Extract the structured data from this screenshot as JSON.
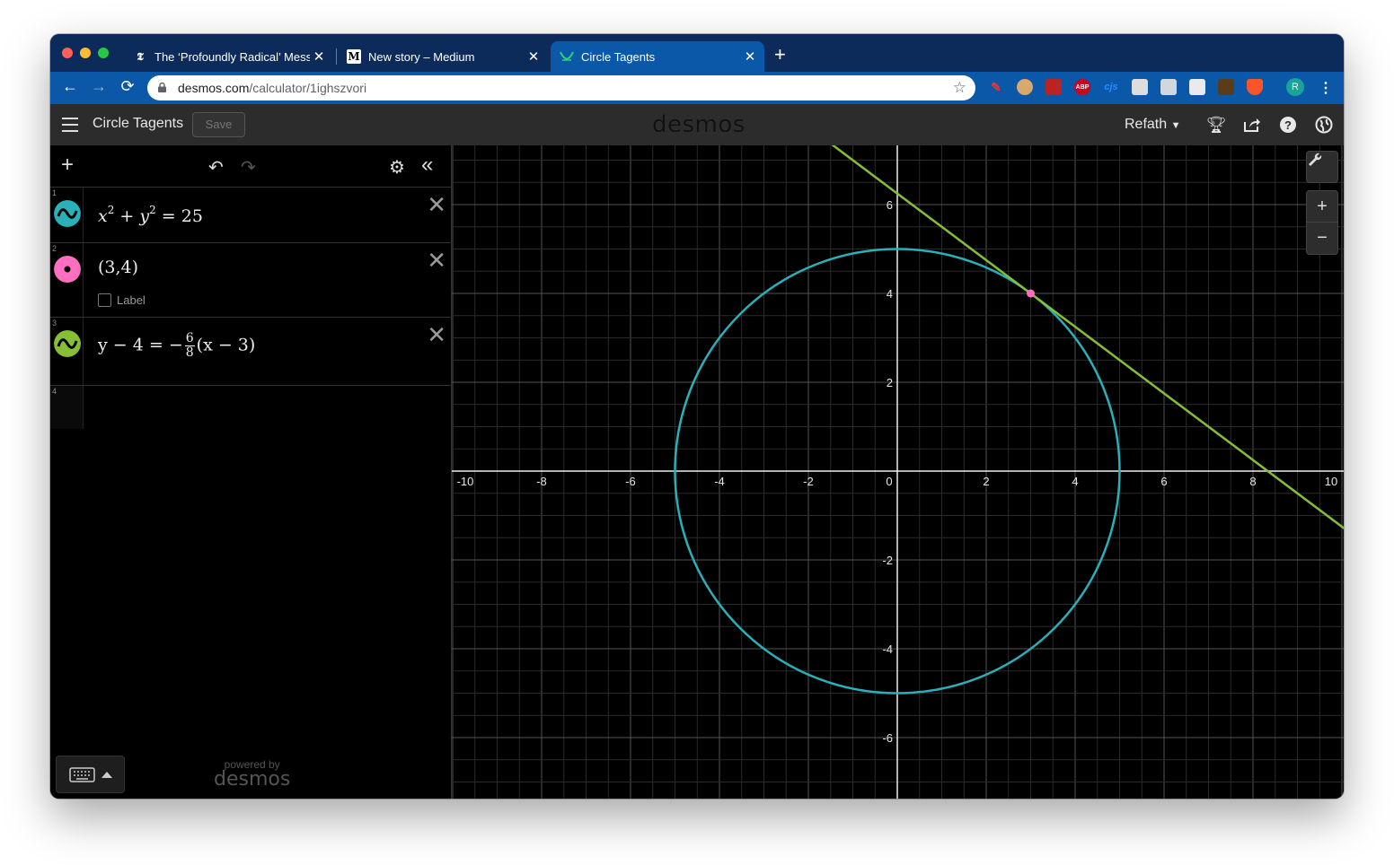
{
  "browser": {
    "tabs": [
      {
        "title": "The ‘Profoundly Radical’ Mess",
        "favicon": "nyt-icon"
      },
      {
        "title": "New story – Medium",
        "favicon": "M"
      },
      {
        "title": "Circle Tagents",
        "favicon": "desmos-icon",
        "active": true
      }
    ],
    "url_host": "desmos.com",
    "url_path": "/calculator/1ighszvori",
    "profile_initial": "R",
    "extensions": [
      "pen-icon",
      "cookie-icon",
      "shield-icon",
      "ABP",
      "cjs",
      "camera-icon",
      "puzzle-icon",
      "badge-icon",
      "fox-icon",
      "brave-icon"
    ]
  },
  "app": {
    "graph_title": "Circle Tagents",
    "save_label": "Save",
    "logo": "desmos",
    "user": "Refath",
    "powered_small": "powered by",
    "powered_big": "desmos"
  },
  "expressions": [
    {
      "num": "1",
      "type": "curve",
      "color": "#2ab0b9",
      "text_parts": [
        "x",
        "2",
        " + ",
        "y",
        "2",
        " = 25"
      ]
    },
    {
      "num": "2",
      "type": "point",
      "color": "#ff6ec0",
      "text": "(3,4)",
      "label_option": "Label"
    },
    {
      "num": "3",
      "type": "curve",
      "color": "#86bf36",
      "lhs": "y − 4 = −",
      "frac_num": "6",
      "frac_den": "8",
      "rhs": "(x − 3)"
    },
    {
      "num": "4",
      "type": "empty"
    }
  ],
  "chart_data": {
    "type": "scatter",
    "xlim": [
      -10.1,
      10
    ],
    "ylim": [
      -7.3,
      7.4
    ],
    "grid": true,
    "x_ticks": [
      "-10",
      "-8",
      "-6",
      "-4",
      "-2",
      "0",
      "2",
      "4",
      "6",
      "8",
      "10"
    ],
    "y_ticks": [
      "-6",
      "-4",
      "-2",
      "2",
      "4",
      "6"
    ],
    "curves": [
      {
        "kind": "circle",
        "equation": "x^2 + y^2 = 25",
        "center": [
          0,
          0
        ],
        "radius": 5,
        "color": "#2ab0b9"
      },
      {
        "kind": "line",
        "equation": "y - 4 = -6/8 (x - 3)",
        "slope": -0.75,
        "point": [
          3,
          4
        ],
        "color": "#86bf36"
      }
    ],
    "points": [
      {
        "x": 3,
        "y": 4,
        "color": "#ff6ec0"
      }
    ]
  }
}
